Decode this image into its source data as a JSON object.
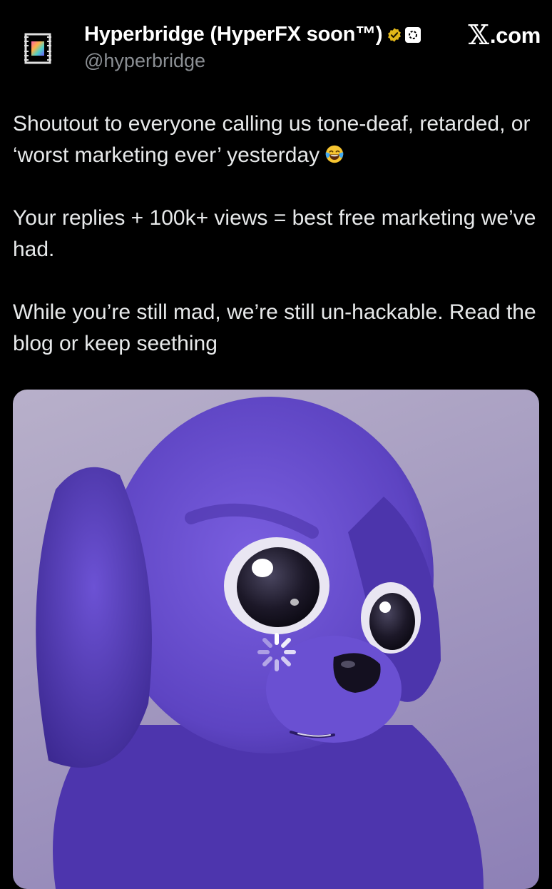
{
  "author": {
    "display_name": "Hyperbridge (HyperFX soon™)",
    "handle": "@hyperbridge",
    "avatar_icon": "hyperbridge-logo-icon",
    "verified_icon": "gold-verified-badge-icon",
    "affiliation_icon": "affiliate-badge-icon"
  },
  "source": {
    "logo_icon": "x-logo-icon",
    "logo_glyph": "𝕏",
    "domain": ".com"
  },
  "tweet": {
    "paragraphs": [
      "Shoutout to everyone calling us tone-deaf, retarded, or ‘worst marketing ever’ yesterday",
      "Your replies + 100k+ views = best free marketing we’ve had.",
      "While you’re still mad, we’re still un-hackable. Read the blog or keep seething"
    ],
    "emoji_icon": "face-with-tears-of-joy-icon"
  },
  "media": {
    "type": "image",
    "subject": "purple-puppy-image",
    "loading_icon": "loading-spinner-icon"
  },
  "colors": {
    "background": "#000000",
    "text": "#e7e9ea",
    "handle": "#8b8f94",
    "verified": "#e2b719",
    "puppy": "#6a4fd0"
  }
}
